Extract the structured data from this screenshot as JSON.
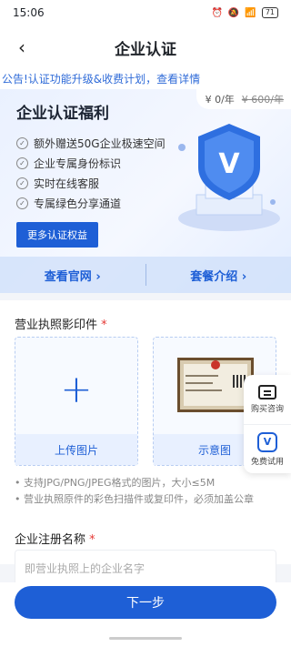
{
  "status_bar": {
    "time": "15:06",
    "battery": "71"
  },
  "nav": {
    "back_icon": "back-arrow-icon",
    "title": "企业认证"
  },
  "notice": {
    "text": "公告!认证功能升级&收费计划，查看详情"
  },
  "hero": {
    "price_now": "¥ 0/年",
    "price_old": "¥ 600/年",
    "title": "企业认证福利",
    "benefits": [
      "额外赠送50G企业极速空间",
      "企业专属身份标识",
      "实时在线客服",
      "专属绿色分享通道"
    ],
    "more_button": "更多认证权益",
    "links": [
      "查看官网 ›",
      "套餐介绍 ›"
    ]
  },
  "upload": {
    "label": "营业执照影印件",
    "required_mark": "*",
    "upload_caption": "上传图片",
    "sample_caption": "示意图",
    "tips": [
      "• 支持JPG/PNG/JPEG格式的图片，大小≤5M",
      "• 营业执照原件的彩色扫描件或复印件，必须加盖公章"
    ]
  },
  "company_name": {
    "label": "企业注册名称",
    "required_mark": "*",
    "placeholder": "即营业执照上的企业名字"
  },
  "float_panel": {
    "consult": "购买咨询",
    "trial": "免费试用",
    "trial_icon_letter": "V"
  },
  "footer": {
    "next_button": "下一步"
  },
  "colors": {
    "primary": "#1e5fd6",
    "required": "#e53935"
  }
}
